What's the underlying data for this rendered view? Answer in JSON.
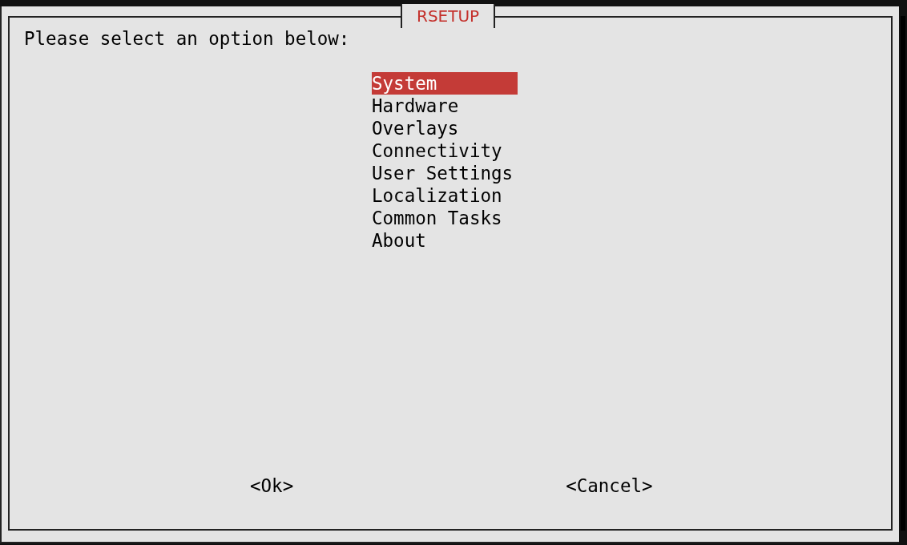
{
  "dialog": {
    "title": "RSETUP",
    "prompt": "Please select an option below:"
  },
  "menu": [
    {
      "label": "System",
      "selected": true
    },
    {
      "label": "Hardware",
      "selected": false
    },
    {
      "label": "Overlays",
      "selected": false
    },
    {
      "label": "Connectivity",
      "selected": false
    },
    {
      "label": "User Settings",
      "selected": false
    },
    {
      "label": "Localization",
      "selected": false
    },
    {
      "label": "Common Tasks",
      "selected": false
    },
    {
      "label": "About",
      "selected": false
    }
  ],
  "buttons": [
    "<Ok>",
    "<Cancel>"
  ]
}
